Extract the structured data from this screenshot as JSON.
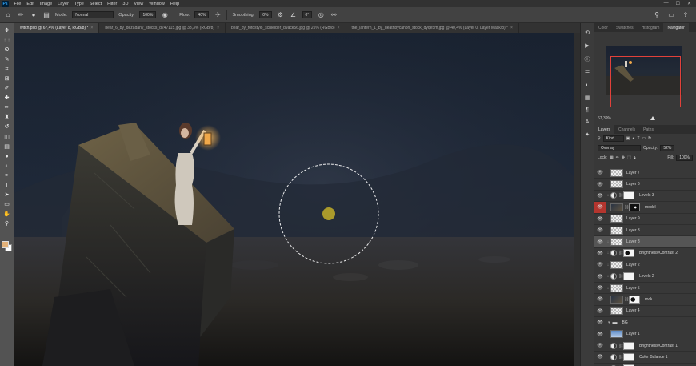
{
  "menubar": {
    "logo": "Ps",
    "items": [
      "File",
      "Edit",
      "Image",
      "Layer",
      "Type",
      "Select",
      "Filter",
      "3D",
      "View",
      "Window",
      "Help"
    ],
    "window_controls": [
      "—",
      "☐",
      "✕"
    ]
  },
  "options": {
    "mode_label": "Mode:",
    "mode_value": "Normal",
    "opacity_label": "Opacity:",
    "opacity_value": "100%",
    "flow_label": "Flow:",
    "flow_value": "40%",
    "smoothing_label": "Smoothing:",
    "smoothing_value": "0%",
    "angle_value": "0°"
  },
  "tabs": [
    {
      "label": "witch.psd @ 67,4% (Layer 8, RGB/8) *",
      "active": true
    },
    {
      "label": "bear_6_by_dezadany_stocks_d247115.jpg @ 33,3% (RGB/8)",
      "active": false
    },
    {
      "label": "bear_by_fotostylo_schielder_d9ack56.jpg @ 25% (RGB/8)",
      "active": false
    },
    {
      "label": "the_lantern_1_by_deathbycanon_stock_dyqe5m.jpg @ 40,4% (Layer 0, Layer Mask/8) *",
      "active": false
    }
  ],
  "tools": [
    "move-icon",
    "marquee-icon",
    "lasso-icon",
    "quick-select-icon",
    "crop-icon",
    "frame-icon",
    "eyedropper-icon",
    "healing-icon",
    "brush-icon",
    "stamp-icon",
    "history-brush-icon",
    "eraser-icon",
    "gradient-icon",
    "blur-icon",
    "dodge-icon",
    "pen-icon",
    "type-icon",
    "path-select-icon",
    "shape-icon",
    "hand-icon",
    "zoom-icon",
    "more-icon"
  ],
  "tool_glyphs": [
    "✥",
    "⬚",
    "ʘ",
    "✎",
    "⌗",
    "⊠",
    "✐",
    "✚",
    "✏",
    "♜",
    "↺",
    "◫",
    "▤",
    "●",
    "◐",
    "✒",
    "T",
    "➤",
    "▭",
    "✋",
    "⚲",
    "…"
  ],
  "colors": {
    "foreground": "#e3b27a",
    "background": "#ffffff",
    "selection_accent": "#e2413a"
  },
  "right_panel": {
    "top_tabs": [
      "Color",
      "Swatches",
      "Histogram",
      "Navigator"
    ],
    "active_top_tab": "Navigator",
    "zoom": "67,39%",
    "layer_tabs": [
      "Layers",
      "Channels",
      "Paths"
    ],
    "filter_kind": "Kind",
    "blend_mode": "Overlay",
    "opacity_label": "Opacity:",
    "opacity_value": "52%",
    "lock_label": "Lock:",
    "fill_label": "Fill:",
    "fill_value": "100%"
  },
  "layers": [
    {
      "name": "Layer 7",
      "thumb": "checker",
      "mask": null,
      "adjust": false,
      "clipped": false,
      "eye_red": false
    },
    {
      "name": "Layer 6",
      "thumb": "checker",
      "mask": null,
      "adjust": false,
      "clipped": false,
      "eye_red": false
    },
    {
      "name": "Levels 3",
      "thumb": "adj",
      "mask": "white",
      "adjust": true,
      "clipped": true,
      "eye_red": false
    },
    {
      "name": "model",
      "thumb": "photo",
      "mask": "black",
      "adjust": false,
      "clipped": false,
      "eye_red": true
    },
    {
      "name": "Layer 9",
      "thumb": "checker",
      "mask": null,
      "adjust": false,
      "clipped": false,
      "eye_red": false
    },
    {
      "name": "Layer 3",
      "thumb": "checker",
      "mask": null,
      "adjust": false,
      "clipped": false,
      "eye_red": false
    },
    {
      "name": "Layer 8",
      "thumb": "checker",
      "mask": null,
      "adjust": false,
      "clipped": true,
      "eye_red": false,
      "selected": true
    },
    {
      "name": "Brightness/Contrast 2",
      "thumb": "adj",
      "mask": "blob",
      "adjust": true,
      "clipped": true,
      "eye_red": false
    },
    {
      "name": "Layer 2",
      "thumb": "checker",
      "mask": null,
      "adjust": false,
      "clipped": true,
      "eye_red": false
    },
    {
      "name": "Levels 2",
      "thumb": "adj",
      "mask": "white",
      "adjust": true,
      "clipped": true,
      "eye_red": false
    },
    {
      "name": "Layer 5",
      "thumb": "checker",
      "mask": null,
      "adjust": false,
      "clipped": true,
      "eye_red": false
    },
    {
      "name": "rock",
      "thumb": "photo",
      "mask": "blob",
      "adjust": false,
      "clipped": false,
      "eye_red": false
    },
    {
      "name": "Layer 4",
      "thumb": "checker",
      "mask": null,
      "adjust": false,
      "clipped": false,
      "eye_red": false
    },
    {
      "name": "BG",
      "thumb": "folder",
      "mask": null,
      "adjust": false,
      "clipped": false,
      "eye_red": false
    },
    {
      "name": "Layer 1",
      "thumb": "sky",
      "mask": null,
      "adjust": false,
      "clipped": false,
      "eye_red": false
    },
    {
      "name": "Brightness/Contrast 1",
      "thumb": "adj",
      "mask": "white",
      "adjust": true,
      "clipped": false,
      "eye_red": false
    },
    {
      "name": "Color Balance 1",
      "thumb": "adj",
      "mask": "white",
      "adjust": true,
      "clipped": false,
      "eye_red": false
    },
    {
      "name": "Hue/Saturation 1",
      "thumb": "adj",
      "mask": "white",
      "adjust": true,
      "clipped": false,
      "eye_red": false
    }
  ]
}
